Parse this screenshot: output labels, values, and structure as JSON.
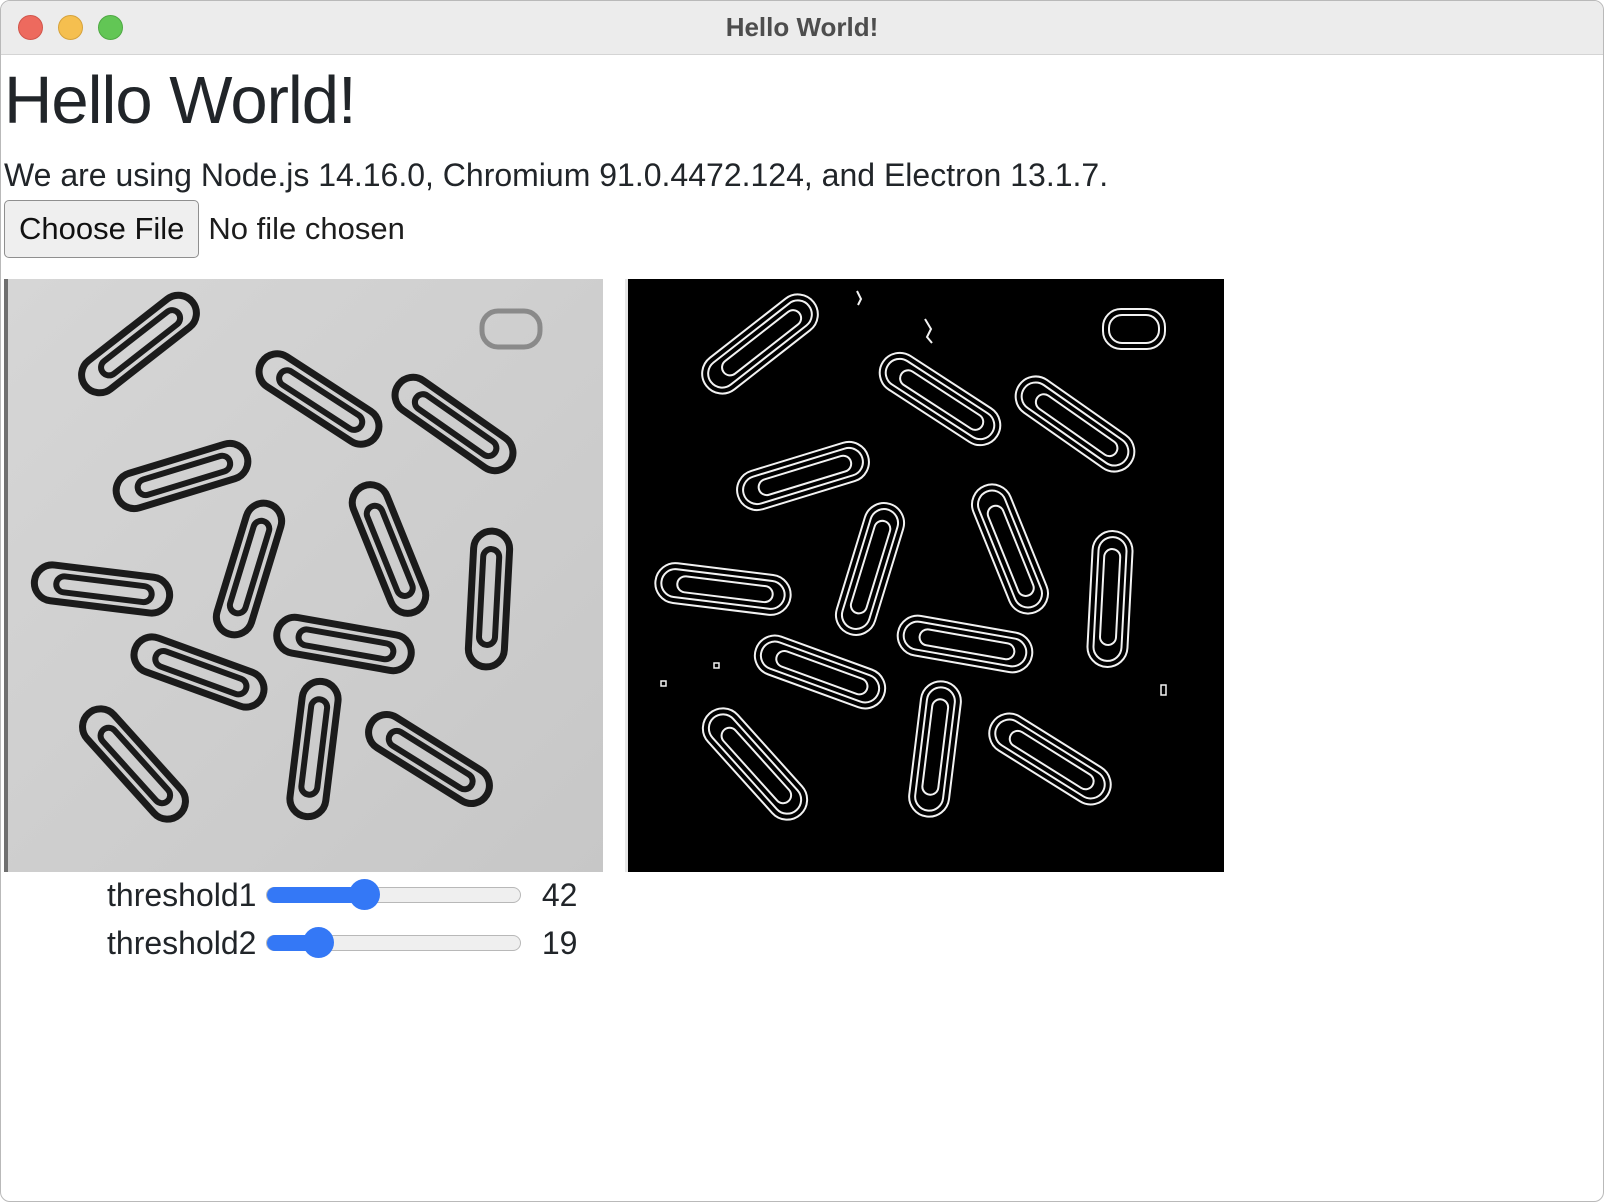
{
  "window": {
    "title": "Hello World!"
  },
  "page": {
    "heading": "Hello World!",
    "versions_text": "We are using Node.js 14.16.0, Chromium 91.0.4472.124, and Electron 13.1.7."
  },
  "file_input": {
    "button_label": "Choose File",
    "status": "No file chosen"
  },
  "images": {
    "original": {
      "description_icon": "paperclips-grayscale-image"
    },
    "edges": {
      "description_icon": "paperclips-edge-detection-image"
    }
  },
  "sliders": [
    {
      "label": "threshold1",
      "value": "42",
      "fraction": 0.38
    },
    {
      "label": "threshold2",
      "value": "19",
      "fraction": 0.2
    }
  ]
}
